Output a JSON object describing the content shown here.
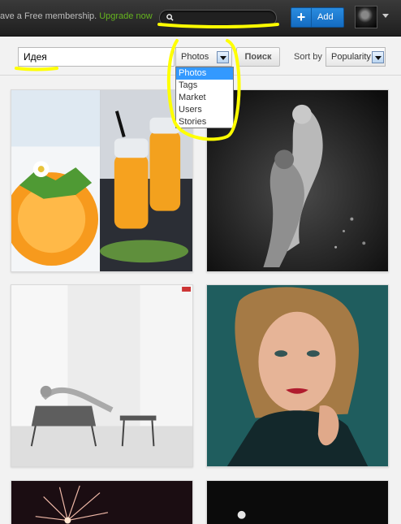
{
  "topbar": {
    "membership_text": "ave a Free membership.",
    "upgrade_link": "Upgrade now",
    "search_placeholder": "",
    "add_label": "Add",
    "add_plus": "+"
  },
  "search": {
    "query_value": "Идея",
    "type_selected": "Photos",
    "type_options": [
      "Photos",
      "Tags",
      "Market",
      "Users",
      "Stories"
    ],
    "submit_label": "Поиск",
    "sort_label": "Sort by",
    "sort_selected": "Popularity"
  },
  "grid": {
    "photos": [
      {
        "subject": "orange-juice-bottles-photo"
      },
      {
        "subject": "couple-dark-art-photo"
      },
      {
        "subject": "woman-in-chair-bw-photo"
      },
      {
        "subject": "woman-portrait-red-lips-photo"
      },
      {
        "subject": "fireworks-photo"
      },
      {
        "subject": "dark-night-photo"
      }
    ]
  },
  "colors": {
    "accent_blue": "#1a7bd1",
    "upgrade_green": "#66b51f",
    "highlight_yellow": "#ffff00",
    "selected_option": "#3399ff"
  }
}
